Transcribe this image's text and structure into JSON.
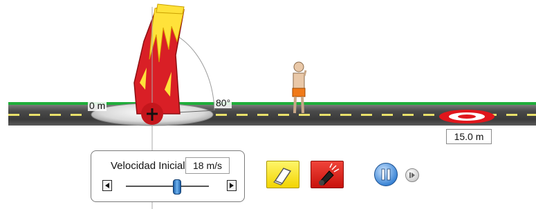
{
  "field": {
    "origin_label": "0 m",
    "angle_label": "80°",
    "target_distance": "15.0 m"
  },
  "controls": {
    "velocity_label": "Velocidad Inicial",
    "velocity_value": "18 m/s",
    "velocity_slider_fraction": 0.62
  },
  "icons": {
    "cannon": "cannon-icon",
    "person": "person-icon",
    "target": "target-icon",
    "eraser": "eraser-icon",
    "fire": "fire-cannon-icon",
    "pause": "pause-icon",
    "step": "step-forward-icon",
    "left_arrow": "arrow-left-icon",
    "right_arrow": "arrow-right-icon"
  },
  "colors": {
    "cannon": "#d91f26",
    "flame": "#ffe23a",
    "grass": "#1fae3a",
    "road": "#444444",
    "target_red": "#e0161c",
    "eraser_button": "#f7e21a",
    "fire_button": "#d8231b",
    "pause_button": "#3d86d6"
  }
}
